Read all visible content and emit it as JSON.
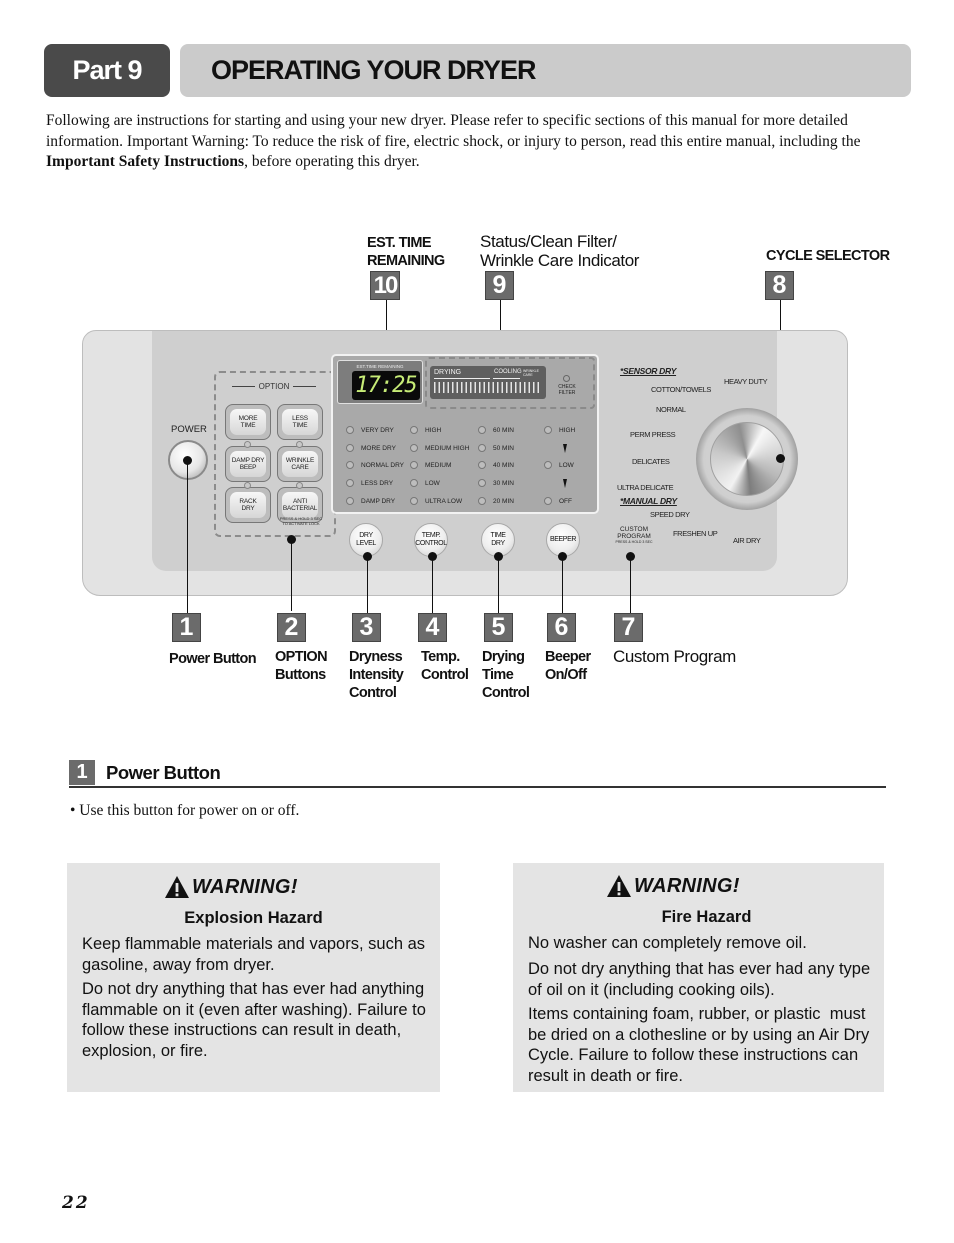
{
  "header": {
    "part_label": "Part 9",
    "title": "OPERATING YOUR DRYER"
  },
  "intro": {
    "before_bold": "Following are instructions for starting and using your new dryer.  Please refer to specific sections of this manual for more detailed information.  Important Warning:  To reduce the risk of fire, electric shock, or injury to person, read this entire manual, including the ",
    "bold": "Important Safety Instructions",
    "after_bold": ", before operating this dryer."
  },
  "top_callouts": [
    {
      "number": "10",
      "label_line1": "EST. TIME",
      "label_line2": "REMAINING"
    },
    {
      "number": "9",
      "label_line1": "Status/Clean Filter/",
      "label_line2": "Wrinkle Care Indicator"
    },
    {
      "number": "8",
      "label_line1": "CYCLE SELECTOR",
      "label_line2": ""
    }
  ],
  "bottom_callouts": [
    {
      "number": "1",
      "lines": [
        "Power Button"
      ]
    },
    {
      "number": "2",
      "lines": [
        "OPTION",
        "Buttons"
      ]
    },
    {
      "number": "3",
      "lines": [
        "Dryness",
        "Intensity",
        "Control"
      ]
    },
    {
      "number": "4",
      "lines": [
        "Temp.",
        "Control"
      ]
    },
    {
      "number": "5",
      "lines": [
        "Drying",
        "Time",
        "Control"
      ]
    },
    {
      "number": "6",
      "lines": [
        "Beeper",
        "On/Off"
      ]
    },
    {
      "number": "7",
      "lines": [
        "Custom Program"
      ]
    }
  ],
  "panel": {
    "power_label": "POWER",
    "option_title": "OPTION",
    "option_buttons": [
      {
        "line1": "MORE",
        "line2": "TIME"
      },
      {
        "line1": "LESS",
        "line2": "TIME"
      },
      {
        "line1": "DAMP DRY",
        "line2": "BEEP"
      },
      {
        "line1": "WRINKLE",
        "line2": "CARE"
      },
      {
        "line1": "RACK",
        "line2": "DRY"
      },
      {
        "line1": "ANTI",
        "line2": "BACTERIAL"
      }
    ],
    "hold_note": "PRESS & HOLD 3 SEC TO ACTIVATE LOCK",
    "display": {
      "time_caption": "EST.TIME REMAINING",
      "time_value": "17:25",
      "status_drying": "DRYING",
      "status_cooling": "COOLING",
      "status_wrinkle": "WRINKLE CARE",
      "check_filter": "CHECK FILTER"
    },
    "dry_level": [
      "VERY DRY",
      "MORE DRY",
      "NORMAL DRY",
      "LESS DRY",
      "DAMP DRY"
    ],
    "temp": [
      "HIGH",
      "MEDIUM HIGH",
      "MEDIUM",
      "LOW",
      "ULTRA LOW"
    ],
    "time": [
      "60 MIN",
      "50 MIN",
      "40 MIN",
      "30 MIN",
      "20 MIN"
    ],
    "beeper": [
      "HIGH",
      "LOW",
      "OFF"
    ],
    "round_buttons": [
      {
        "line1": "DRY",
        "line2": "LEVEL"
      },
      {
        "line1": "TEMP.",
        "line2": "CONTROL"
      },
      {
        "line1": "TIME",
        "line2": "DRY"
      },
      {
        "line1": "BEEPER",
        "line2": ""
      }
    ],
    "custom_program": {
      "line1": "CUSTOM",
      "line2": "PROGRAM",
      "note": "PRESS & HOLD 3 SEC"
    },
    "cycle": {
      "sensor_head": "*SENSOR DRY",
      "manual_head": "*MANUAL DRY",
      "items": [
        "HEAVY DUTY",
        "COTTON/TOWELS",
        "NORMAL",
        "PERM PRESS",
        "DELICATES",
        "ULTRA DELICATE",
        "SPEED DRY",
        "FRESHEN UP",
        "AIR DRY"
      ]
    }
  },
  "section": {
    "number": "1",
    "title": "Power Button",
    "bullet": "• Use this button for power on or off."
  },
  "warnings": [
    {
      "heading": "WARNING!",
      "subheading": "Explosion Hazard",
      "paragraphs": [
        "Keep flammable materials and vapors, such as gasoline, away from dryer.",
        "Do not dry anything that has ever had anything flammable on it (even after washing). Failure to follow these instructions can result in death, explosion, or fire."
      ]
    },
    {
      "heading": "WARNING!",
      "subheading": "Fire Hazard",
      "paragraphs": [
        "No washer can completely remove oil.",
        "Do not dry anything that has ever had any type of oil on it (including cooking oils).",
        "Items containing foam, rubber, or plastic  must be dried on a clothesline or by using an Air Dry Cycle. Failure to follow these instructions can result in death or fire."
      ]
    }
  ],
  "page_number": "22"
}
